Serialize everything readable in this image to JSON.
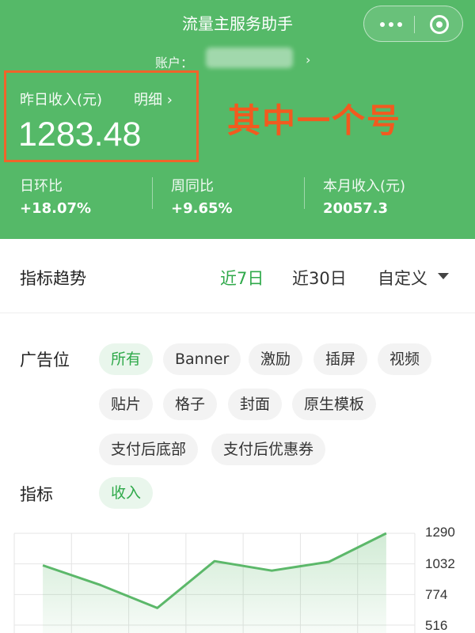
{
  "header": {
    "title": "流量主服务助手",
    "account_label": "账户：",
    "account_arrow": "›",
    "income_label": "昨日收入(元)",
    "detail_link": "明细 ›",
    "income_value": "1283.48",
    "annotation": "其中一个号",
    "stats": [
      {
        "label": "日环比",
        "value": "+18.07%"
      },
      {
        "label": "周同比",
        "value": "+9.65%"
      },
      {
        "label": "本月收入(元)",
        "value": "20057.3"
      }
    ]
  },
  "trend": {
    "title": "指标趋势",
    "ranges": [
      "近7日",
      "近30日",
      "自定义"
    ],
    "active_range": "近7日"
  },
  "ad_position": {
    "label": "广告位",
    "tags": [
      "所有",
      "Banner",
      "激励",
      "插屏",
      "视频",
      "贴片",
      "格子",
      "封面",
      "原生模板",
      "支付后底部",
      "支付后优惠券"
    ],
    "active": "所有"
  },
  "metric": {
    "label": "指标",
    "tags": [
      "收入"
    ],
    "active": "收入"
  },
  "chart_data": {
    "type": "area",
    "series": [
      {
        "values": [
          1020,
          855,
          660,
          1055,
          975,
          1050,
          1290
        ]
      }
    ],
    "y_ticks": [
      "1290",
      "1032",
      "774",
      "516"
    ],
    "ylim": [
      516,
      1290
    ],
    "line_color": "#5cb86a",
    "fill_color": "#e6f4e8",
    "grid": true
  },
  "colors": {
    "brand_green": "#55b968",
    "active_green": "#2fa94a",
    "highlight": "#f0642a",
    "annotation": "#f25a1f"
  }
}
